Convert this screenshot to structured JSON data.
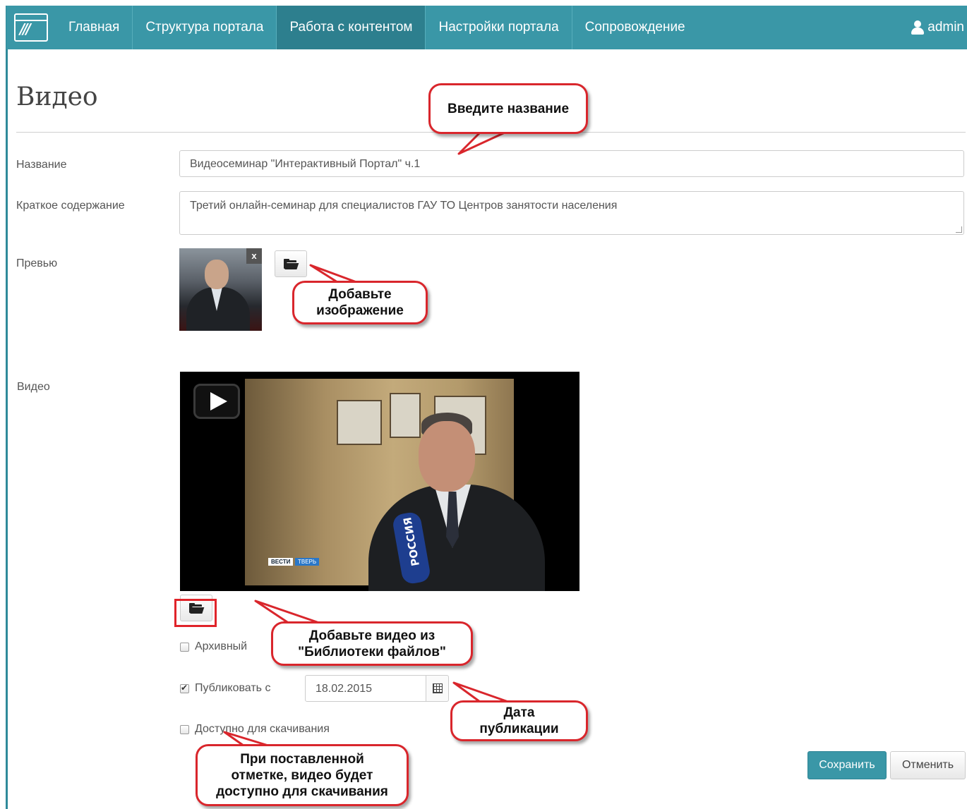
{
  "nav": {
    "items": [
      "Главная",
      "Структура портала",
      "Работа с контентом",
      "Настройки портала",
      "Сопровождение"
    ],
    "active_index": 2,
    "user": "admin"
  },
  "page": {
    "title": "Видео"
  },
  "form": {
    "name_label": "Название",
    "name_value": "Видеосеминар \"Интерактивный Портал\" ч.1",
    "summary_label": "Краткое содержание",
    "summary_value": "Третий онлайн-семинар для специалистов ГАУ ТО Центров занятости населения",
    "preview_label": "Превью",
    "preview_remove": "x",
    "video_label": "Видео",
    "video_overlay_text": "РОССИЯ",
    "video_tag_1": "ВЕСТИ",
    "video_tag_2": "ТВЕРЬ",
    "archive_label": "Архивный",
    "archive_checked": false,
    "publish_label": "Публиковать с",
    "publish_checked": true,
    "publish_date": "18.02.2015",
    "download_label": "Доступно для скачивания",
    "download_checked": false
  },
  "actions": {
    "save": "Сохранить",
    "cancel": "Отменить"
  },
  "callouts": {
    "name": "Введите название",
    "image_line1": "Добавьте",
    "image_line2": "изображение",
    "video_line1": "Добавьте видео из",
    "video_line2": "\"Библиотеки файлов\"",
    "date_line1": "Дата",
    "date_line2": "публикации",
    "download_line1": "При поставленной",
    "download_line2": "отметке, видео будет",
    "download_line3": "доступно для скачивания"
  },
  "colors": {
    "accent": "#3a97a7",
    "accent_dark": "#2d7f8e",
    "callout_border": "#d9262c"
  },
  "icons": [
    "logo-icon",
    "user-icon",
    "folder-open-icon",
    "calendar-icon",
    "play-icon"
  ]
}
